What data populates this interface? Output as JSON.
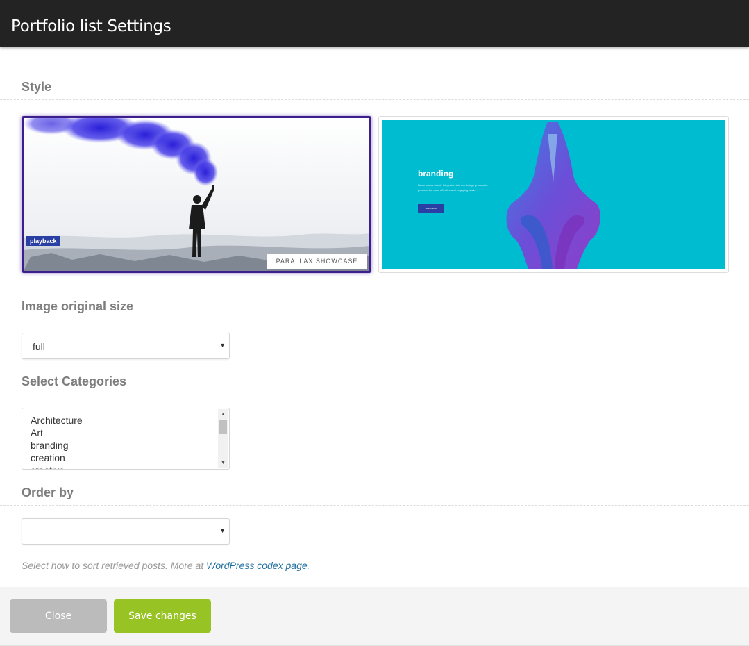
{
  "header": {
    "title": "Portfolio list Settings"
  },
  "style_section": {
    "label": "Style",
    "options": [
      {
        "badge": "playback",
        "caption": "PARALLAX SHOWCASE",
        "selected": true
      },
      {
        "heading": "branding",
        "description": "Ideas is seamlessly integrated into our design process to produce the most effective and engaging work.",
        "button": "see more",
        "selected": false
      }
    ]
  },
  "image_size": {
    "label": "Image original size",
    "value": "full"
  },
  "categories": {
    "label": "Select Categories",
    "items": [
      "Architecture",
      "Art",
      "branding",
      "creation",
      "creative"
    ]
  },
  "order_by": {
    "label": "Order by",
    "value": "",
    "help_prefix": "Select how to sort retrieved posts. More at ",
    "help_link": "WordPress codex page",
    "help_suffix": "."
  },
  "footer": {
    "close_label": "Close",
    "save_label": "Save changes"
  },
  "colors": {
    "header_bg": "#232323",
    "selected_border": "#3b1f8c",
    "teal": "#00bcd0",
    "smoke_blue": "#3b2de0",
    "save_green": "#97c424",
    "close_gray": "#bbbbbb"
  },
  "icons": [
    "dropdown-arrow-icon",
    "scroll-up-icon",
    "scroll-down-icon"
  ]
}
